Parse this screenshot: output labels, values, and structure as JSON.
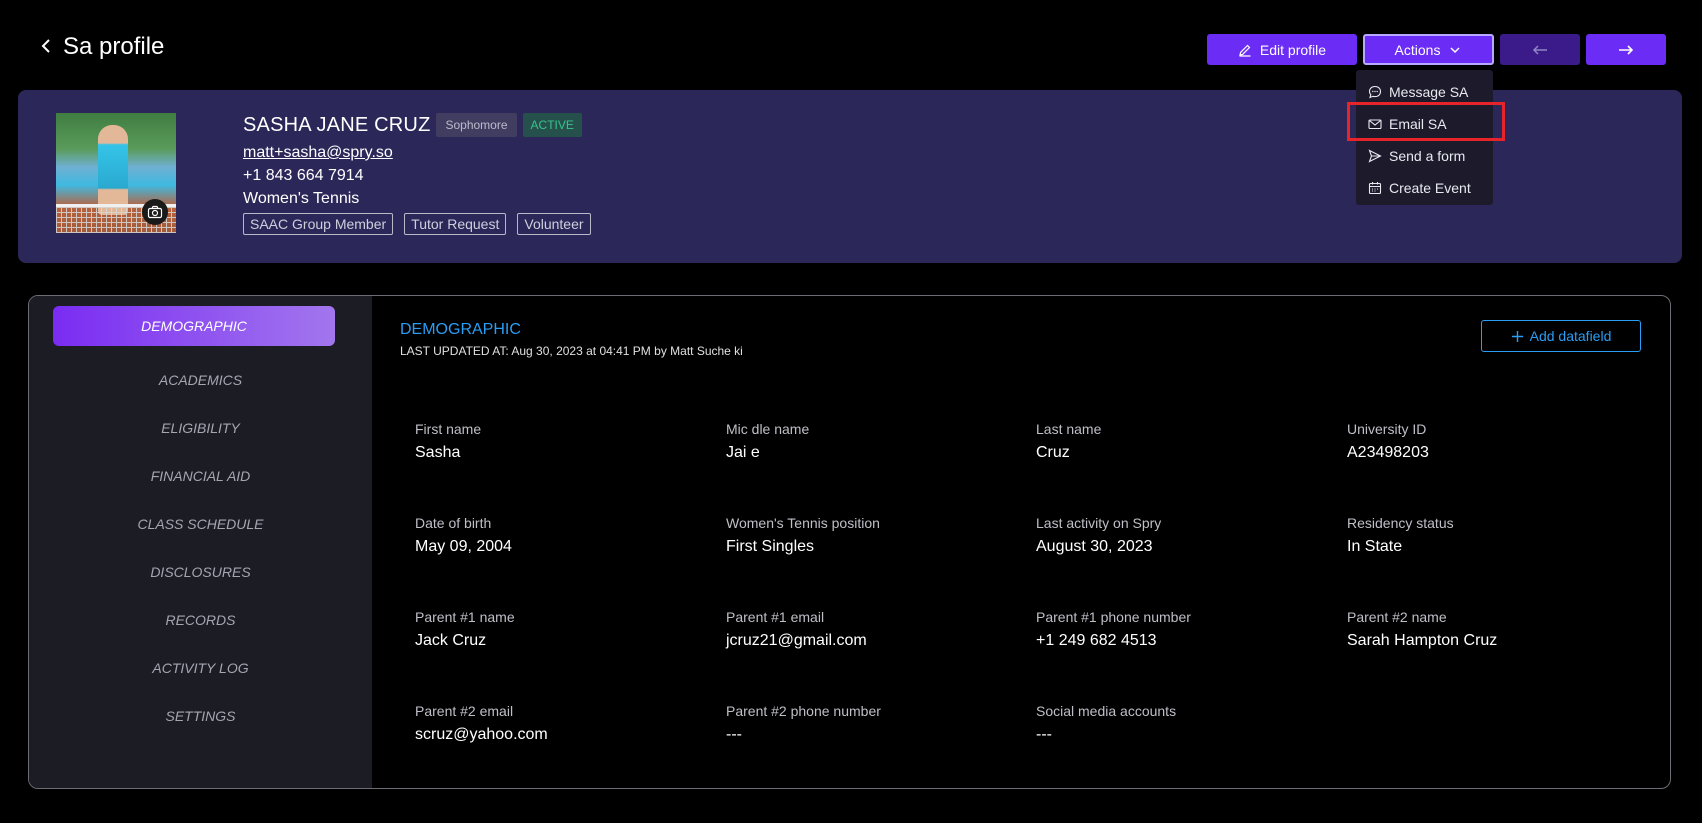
{
  "header": {
    "title": "Sa profile",
    "edit_label": "Edit profile",
    "actions_label": "Actions"
  },
  "actions_menu": {
    "items": [
      {
        "label": "Message SA",
        "icon": "message-icon"
      },
      {
        "label": "Email SA",
        "icon": "mail-icon"
      },
      {
        "label": "Send a form",
        "icon": "send-icon"
      },
      {
        "label": "Create Event",
        "icon": "calendar-icon"
      }
    ],
    "highlighted": "Email SA",
    "highlight_color": "#e8242b"
  },
  "profile": {
    "name": "SASHA JANE CRUZ",
    "year": "Sophomore",
    "status": "ACTIVE",
    "email": "matt+sasha@spry.so",
    "phone": "+1 843 664 7914",
    "sport": "Women's Tennis",
    "tags": [
      "SAAC Group Member",
      "Tutor Request",
      "Volunteer"
    ]
  },
  "sidebar": {
    "items": [
      {
        "label": "DEMOGRAPHIC",
        "active": true
      },
      {
        "label": "ACADEMICS"
      },
      {
        "label": "ELIGIBILITY"
      },
      {
        "label": "FINANCIAL AID"
      },
      {
        "label": "CLASS SCHEDULE"
      },
      {
        "label": "DISCLOSURES"
      },
      {
        "label": "RECORDS"
      },
      {
        "label": "ACTIVITY LOG"
      },
      {
        "label": "SETTINGS"
      }
    ]
  },
  "main": {
    "section_title": "DEMOGRAPHIC",
    "last_updated": "LAST UPDATED AT: Aug 30, 2023 at 04:41 PM by Matt Suche ki",
    "add_label": "Add datafield",
    "fields": [
      {
        "label": "First name",
        "value": "Sasha"
      },
      {
        "label": "Mic dle name",
        "value": "Jai e"
      },
      {
        "label": "Last name",
        "value": "Cruz"
      },
      {
        "label": "University ID",
        "value": "A23498203"
      },
      {
        "label": "Date of birth",
        "value": "May 09, 2004"
      },
      {
        "label": "Women's Tennis position",
        "value": "First Singles"
      },
      {
        "label": "Last activity on Spry",
        "value": "August 30, 2023"
      },
      {
        "label": "Residency status",
        "value": "In State"
      },
      {
        "label": "Parent #1 name",
        "value": "Jack Cruz"
      },
      {
        "label": "Parent #1 email",
        "value": "jcruz21@gmail.com"
      },
      {
        "label": "Parent #1 phone number",
        "value": "+1 249 682 4513"
      },
      {
        "label": "Parent #2 name",
        "value": "Sarah Hampton Cruz"
      },
      {
        "label": "Parent #2 email",
        "value": "scruz@yahoo.com"
      },
      {
        "label": "Parent #2 phone number",
        "value": "---"
      },
      {
        "label": "Social media accounts",
        "value": "---"
      }
    ]
  },
  "colors": {
    "accent": "#6b2cf5",
    "banner": "#2b2759",
    "link_blue": "#2a9df4",
    "active_green": "#37c48a"
  }
}
